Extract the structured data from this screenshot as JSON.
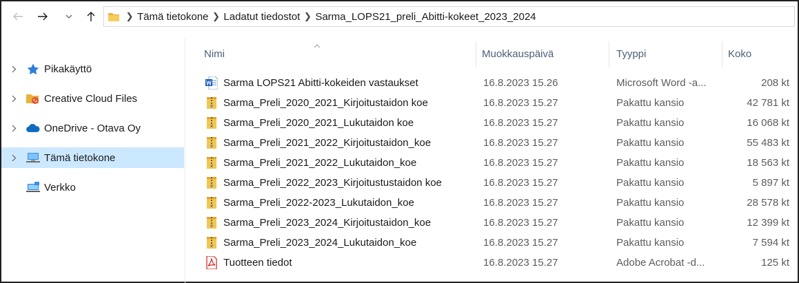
{
  "breadcrumb": [
    "Tämä tietokone",
    "Ladatut tiedostot",
    "Sarma_LOPS21_preli_Abitti-kokeet_2023_2024"
  ],
  "sidebar": {
    "items": [
      {
        "label": "Pikakäyttö",
        "icon": "star-icon",
        "expandable": true,
        "selected": false
      },
      {
        "label": "Creative Cloud Files",
        "icon": "creative-cloud-folder-icon",
        "expandable": true,
        "selected": false
      },
      {
        "label": "OneDrive - Otava Oy",
        "icon": "onedrive-cloud-icon",
        "expandable": true,
        "selected": false
      },
      {
        "label": "Tämä tietokone",
        "icon": "computer-icon",
        "expandable": true,
        "selected": true
      },
      {
        "label": "Verkko",
        "icon": "network-icon",
        "expandable": false,
        "selected": false
      }
    ]
  },
  "columns": {
    "name": "Nimi",
    "date": "Muokkauspäivä",
    "type": "Tyyppi",
    "size": "Koko"
  },
  "files": [
    {
      "name": "Sarma LOPS21 Abitti-kokeiden vastaukset",
      "date": "16.8.2023 15.26",
      "type": "Microsoft Word -a...",
      "size": "208 kt",
      "icon": "word-document-icon"
    },
    {
      "name": "Sarma_Preli_2020_2021_Kirjoitustaidon koe",
      "date": "16.8.2023 15.27",
      "type": "Pakattu kansio",
      "size": "42 781 kt",
      "icon": "zip-folder-icon"
    },
    {
      "name": "Sarma_Preli_2020_2021_Lukutaidon koe",
      "date": "16.8.2023 15.27",
      "type": "Pakattu kansio",
      "size": "16 068 kt",
      "icon": "zip-folder-icon"
    },
    {
      "name": "Sarma_Preli_2021_2022_Kirjoitustaidon_koe",
      "date": "16.8.2023 15.27",
      "type": "Pakattu kansio",
      "size": "55 483 kt",
      "icon": "zip-folder-icon"
    },
    {
      "name": "Sarma_Preli_2021_2022_Lukutaidon_koe",
      "date": "16.8.2023 15.27",
      "type": "Pakattu kansio",
      "size": "18 563 kt",
      "icon": "zip-folder-icon"
    },
    {
      "name": "Sarma_Preli_2022_2023_Kirjoitustustaidon koe",
      "date": "16.8.2023 15.27",
      "type": "Pakattu kansio",
      "size": "5 897 kt",
      "icon": "zip-folder-icon"
    },
    {
      "name": "Sarma_Preli_2022-2023_Lukutaidon_koe",
      "date": "16.8.2023 15.27",
      "type": "Pakattu kansio",
      "size": "28 578 kt",
      "icon": "zip-folder-icon"
    },
    {
      "name": "Sarma_Preli_2023_2024_Kirjoitustaidon_koe",
      "date": "16.8.2023 15.27",
      "type": "Pakattu kansio",
      "size": "12 399 kt",
      "icon": "zip-folder-icon"
    },
    {
      "name": "Sarma_Preli_2023_2024_Lukutaidon_koe",
      "date": "16.8.2023 15.27",
      "type": "Pakattu kansio",
      "size": "7 594 kt",
      "icon": "zip-folder-icon"
    },
    {
      "name": "Tuotteen tiedot",
      "date": "16.8.2023 15.27",
      "type": "Adobe Acrobat -d...",
      "size": "125 kt",
      "icon": "pdf-document-icon"
    }
  ]
}
